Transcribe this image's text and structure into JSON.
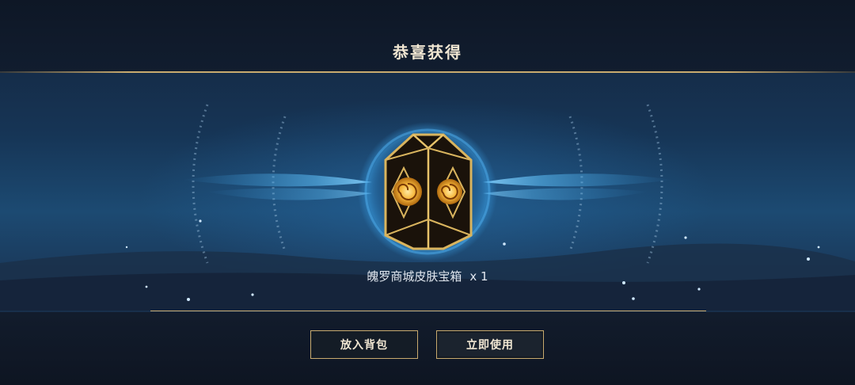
{
  "header": {
    "title": "恭喜获得"
  },
  "reward": {
    "name": "魄罗商城皮肤宝箱",
    "quantity": "x 1",
    "icon": "skin-chest-icon"
  },
  "actions": {
    "bag_label": "放入背包",
    "use_label": "立即使用"
  },
  "colors": {
    "gold": "#c8aa6e",
    "text": "#f0e6d2",
    "glow": "#3aa0e6"
  }
}
